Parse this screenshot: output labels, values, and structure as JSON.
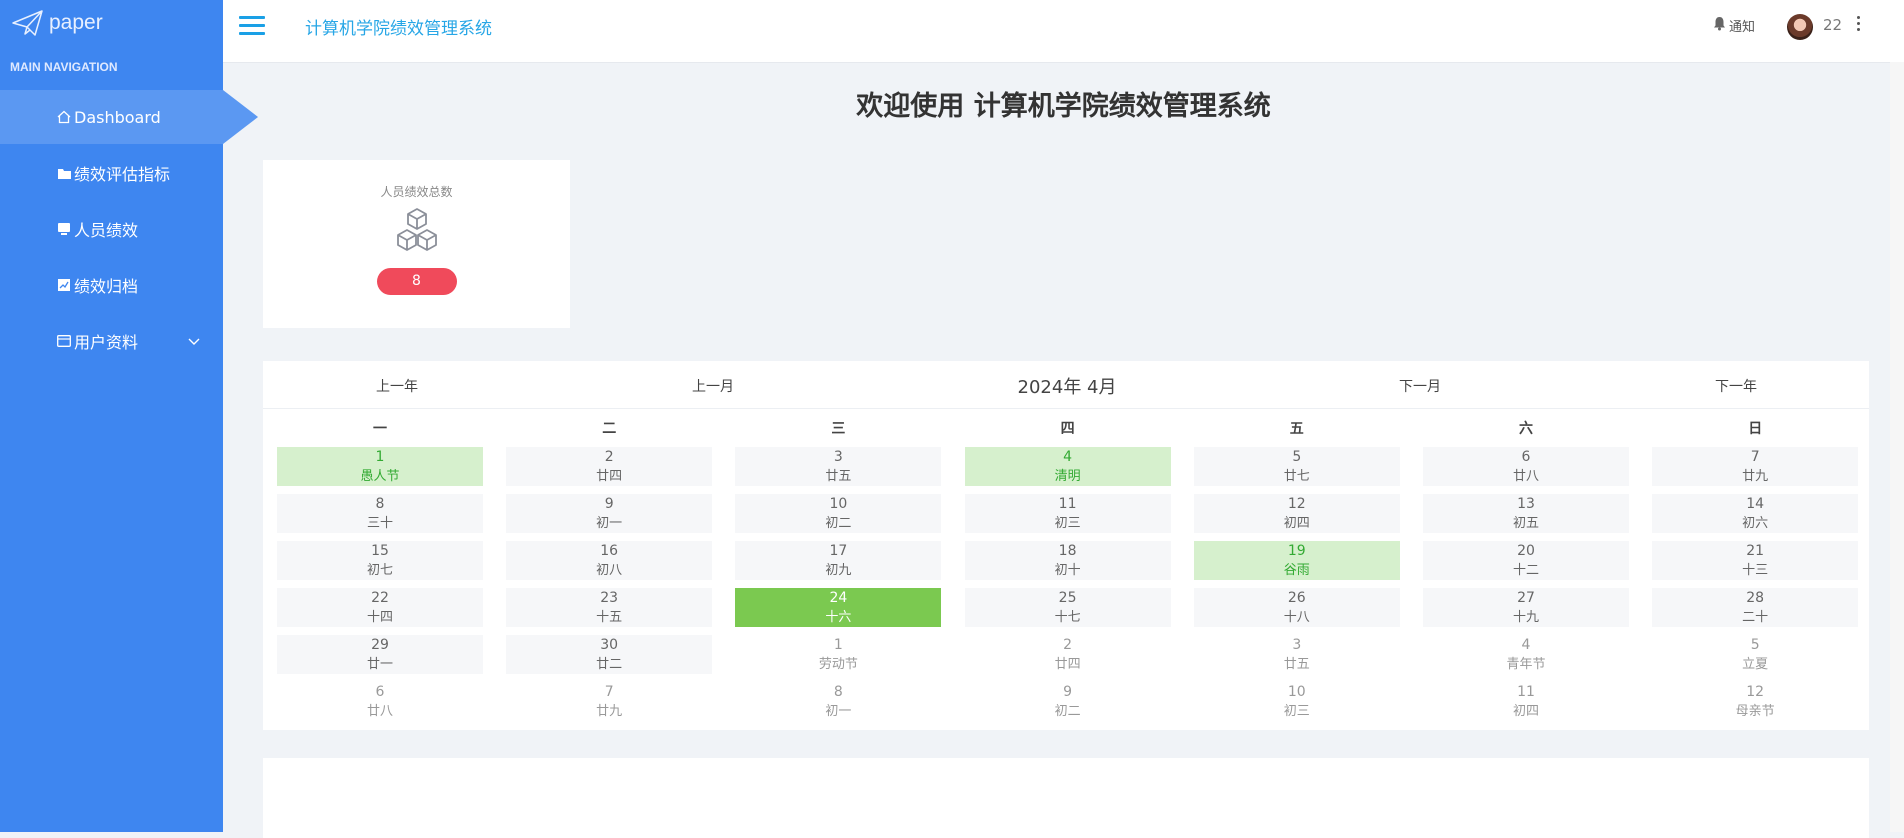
{
  "sidebar": {
    "logo_text": "paper",
    "nav_title": "MAIN NAVIGATION",
    "items": [
      {
        "label": "Dashboard",
        "icon": "home-icon"
      },
      {
        "label": "绩效评估指标",
        "icon": "folder-icon"
      },
      {
        "label": "人员绩效",
        "icon": "monitor-icon"
      },
      {
        "label": "绩效归档",
        "icon": "chart-icon"
      },
      {
        "label": "用户资料",
        "icon": "card-icon"
      }
    ]
  },
  "header": {
    "system_title": "计算机学院绩效管理系统",
    "notify_label": "通知",
    "username": "22"
  },
  "main": {
    "welcome": "欢迎使用 计算机学院绩效管理系统",
    "stat_card": {
      "label": "人员绩效总数",
      "value": "8",
      "icon": "cubes-icon"
    }
  },
  "calendar": {
    "prev_year": "上一年",
    "prev_month": "上一月",
    "month_label": "2024年 4月",
    "next_month": "下一月",
    "next_year": "下一年",
    "weekdays": [
      "一",
      "二",
      "三",
      "四",
      "五",
      "六",
      "日"
    ],
    "weeks": [
      [
        {
          "d": "1",
          "l": "愚人节",
          "s": "hl"
        },
        {
          "d": "2",
          "l": "廿四"
        },
        {
          "d": "3",
          "l": "廿五"
        },
        {
          "d": "4",
          "l": "清明",
          "s": "hl"
        },
        {
          "d": "5",
          "l": "廿七"
        },
        {
          "d": "6",
          "l": "廿八"
        },
        {
          "d": "7",
          "l": "廿九"
        }
      ],
      [
        {
          "d": "8",
          "l": "三十"
        },
        {
          "d": "9",
          "l": "初一"
        },
        {
          "d": "10",
          "l": "初二"
        },
        {
          "d": "11",
          "l": "初三"
        },
        {
          "d": "12",
          "l": "初四"
        },
        {
          "d": "13",
          "l": "初五"
        },
        {
          "d": "14",
          "l": "初六"
        }
      ],
      [
        {
          "d": "15",
          "l": "初七"
        },
        {
          "d": "16",
          "l": "初八"
        },
        {
          "d": "17",
          "l": "初九"
        },
        {
          "d": "18",
          "l": "初十"
        },
        {
          "d": "19",
          "l": "谷雨",
          "s": "hl"
        },
        {
          "d": "20",
          "l": "十二"
        },
        {
          "d": "21",
          "l": "十三"
        }
      ],
      [
        {
          "d": "22",
          "l": "十四"
        },
        {
          "d": "23",
          "l": "十五"
        },
        {
          "d": "24",
          "l": "十六",
          "s": "sel"
        },
        {
          "d": "25",
          "l": "十七"
        },
        {
          "d": "26",
          "l": "十八"
        },
        {
          "d": "27",
          "l": "十九"
        },
        {
          "d": "28",
          "l": "二十"
        }
      ],
      [
        {
          "d": "29",
          "l": "廿一"
        },
        {
          "d": "30",
          "l": "廿二"
        },
        {
          "d": "1",
          "l": "劳动节",
          "s": "other"
        },
        {
          "d": "2",
          "l": "廿四",
          "s": "other"
        },
        {
          "d": "3",
          "l": "廿五",
          "s": "other"
        },
        {
          "d": "4",
          "l": "青年节",
          "s": "other"
        },
        {
          "d": "5",
          "l": "立夏",
          "s": "other"
        }
      ],
      [
        {
          "d": "6",
          "l": "廿八",
          "s": "other"
        },
        {
          "d": "7",
          "l": "廿九",
          "s": "other"
        },
        {
          "d": "8",
          "l": "初一",
          "s": "other"
        },
        {
          "d": "9",
          "l": "初二",
          "s": "other"
        },
        {
          "d": "10",
          "l": "初三",
          "s": "other"
        },
        {
          "d": "11",
          "l": "初四",
          "s": "other"
        },
        {
          "d": "12",
          "l": "母亲节",
          "s": "other"
        }
      ]
    ]
  },
  "colors": {
    "sidebar": "#3e86f0",
    "accent": "#27a6e6",
    "badge": "#f04a5b",
    "selected_day": "#7bc950",
    "holiday_day": "#d6f0cd"
  }
}
